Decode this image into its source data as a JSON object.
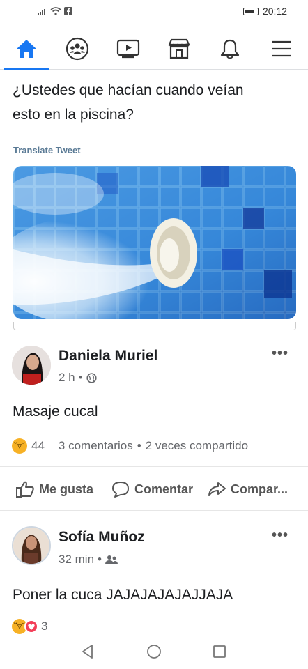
{
  "status_bar": {
    "time": "20:12"
  },
  "nav": {
    "items": [
      {
        "name": "home",
        "active": true
      },
      {
        "name": "groups"
      },
      {
        "name": "watch"
      },
      {
        "name": "marketplace"
      },
      {
        "name": "notifications"
      },
      {
        "name": "menu"
      }
    ],
    "accent": "#1877f2"
  },
  "post": {
    "text_line1": "¿Ustedes que hacían cuando veían",
    "text_line2": "esto en la piscina?",
    "translate_label": "Translate Tweet"
  },
  "comments": [
    {
      "author": "Daniela Muriel",
      "time": "2 h",
      "privacy_icon": "globe-icon",
      "text": "Masaje cucal",
      "reaction_count": "44",
      "comments_count": "3 comentarios",
      "shares": "2 veces compartido"
    },
    {
      "author": "Sofía Muñoz",
      "time": "32 min",
      "privacy_icon": "friends-icon",
      "text": "Poner la cuca JAJAJAJAJAJJAJA",
      "reaction_count": "3"
    }
  ],
  "actions": {
    "like": "Me gusta",
    "comment": "Comentar",
    "share": "Compar..."
  },
  "more_label": "•••"
}
